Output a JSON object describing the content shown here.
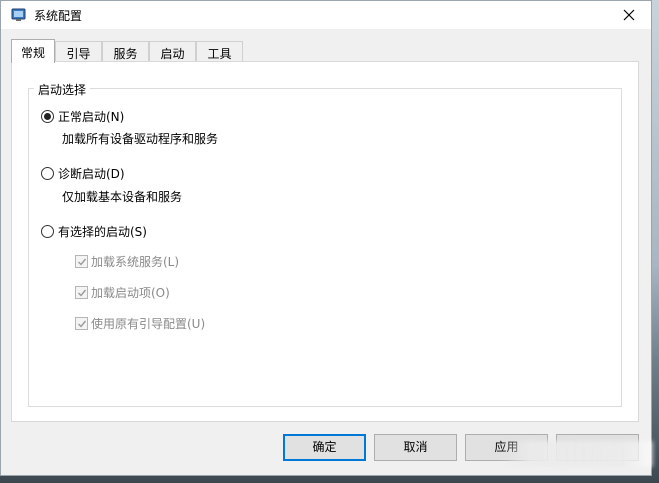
{
  "window": {
    "title": "系统配置",
    "icon": "msconfig-icon"
  },
  "tabs": [
    {
      "label": "常规"
    },
    {
      "label": "引导"
    },
    {
      "label": "服务"
    },
    {
      "label": "启动"
    },
    {
      "label": "工具"
    }
  ],
  "startup_selection": {
    "legend": "启动选择",
    "normal": {
      "label": "正常启动(N)",
      "desc": "加载所有设备驱动程序和服务",
      "selected": true
    },
    "diagnostic": {
      "label": "诊断启动(D)",
      "desc": "仅加载基本设备和服务",
      "selected": false
    },
    "selective": {
      "label": "有选择的启动(S)",
      "selected": false,
      "options": [
        {
          "label": "加载系统服务(L)",
          "checked": true
        },
        {
          "label": "加载启动项(O)",
          "checked": true
        },
        {
          "label": "使用原有引导配置(U)",
          "checked": true
        }
      ]
    }
  },
  "buttons": {
    "ok": "确定",
    "cancel": "取消",
    "apply": "应用"
  }
}
